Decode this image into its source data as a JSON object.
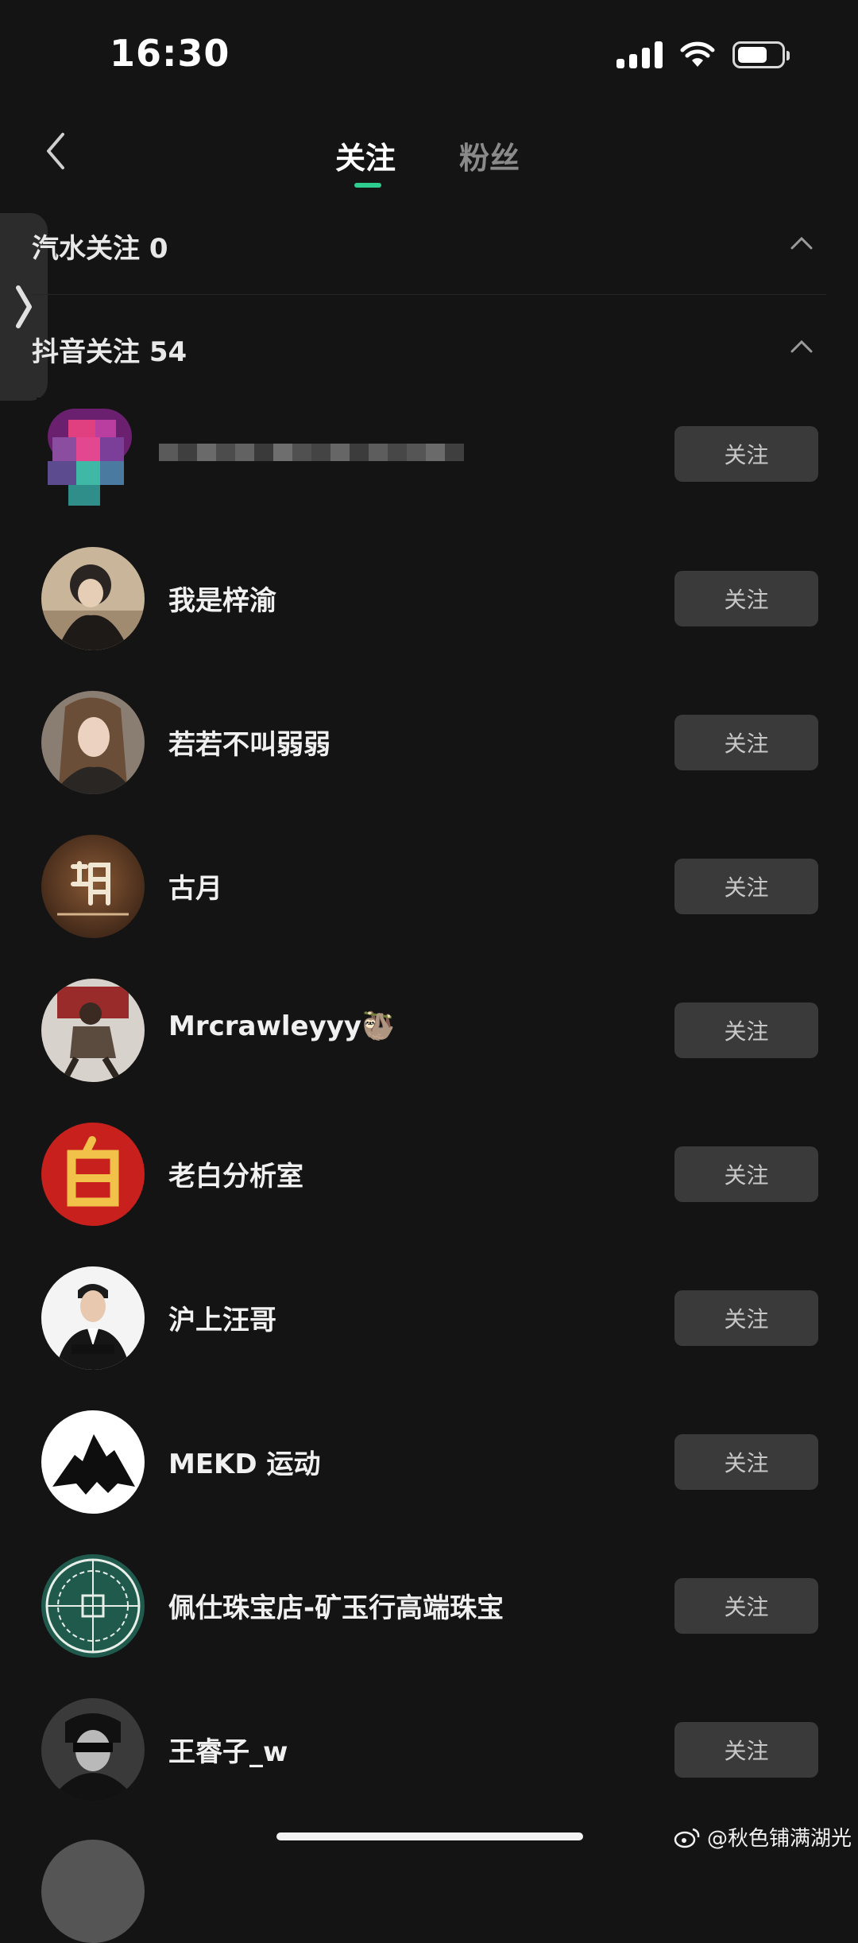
{
  "status_bar": {
    "time": "16:30"
  },
  "nav": {
    "tabs": [
      {
        "label": "关注",
        "active": true
      },
      {
        "label": "粉丝",
        "active": false
      }
    ],
    "accent_color": "#2ecc8e"
  },
  "sections": [
    {
      "title": "汽水关注 0",
      "icon": "chevron-up-icon"
    },
    {
      "title": "抖音关注 54",
      "icon": "chevron-up-icon"
    }
  ],
  "users": [
    {
      "name": "",
      "button": "关注",
      "avatar": "pixelated-avatar"
    },
    {
      "name": "我是梓渝",
      "button": "关注",
      "avatar": "portrait-avatar"
    },
    {
      "name": "若若不叫弱弱",
      "button": "关注",
      "avatar": "portrait-avatar"
    },
    {
      "name": "古月",
      "button": "关注",
      "avatar": "calligraphy-hu-avatar"
    },
    {
      "name": "Mrcrawleyyy🦥",
      "button": "关注",
      "avatar": "photo-avatar"
    },
    {
      "name": "老白分析室",
      "button": "关注",
      "avatar": "bai-character-avatar"
    },
    {
      "name": "沪上汪哥",
      "button": "关注",
      "avatar": "suit-portrait-avatar"
    },
    {
      "name": "MEKD 运动",
      "button": "关注",
      "avatar": "mountain-logo-avatar"
    },
    {
      "name": "佩仕珠宝店-矿玉行高端珠宝",
      "button": "关注",
      "avatar": "jade-pattern-avatar"
    },
    {
      "name": "王睿子_w",
      "button": "关注",
      "avatar": "sunglasses-portrait-avatar"
    }
  ],
  "watermark": "@秋色铺满湖光"
}
